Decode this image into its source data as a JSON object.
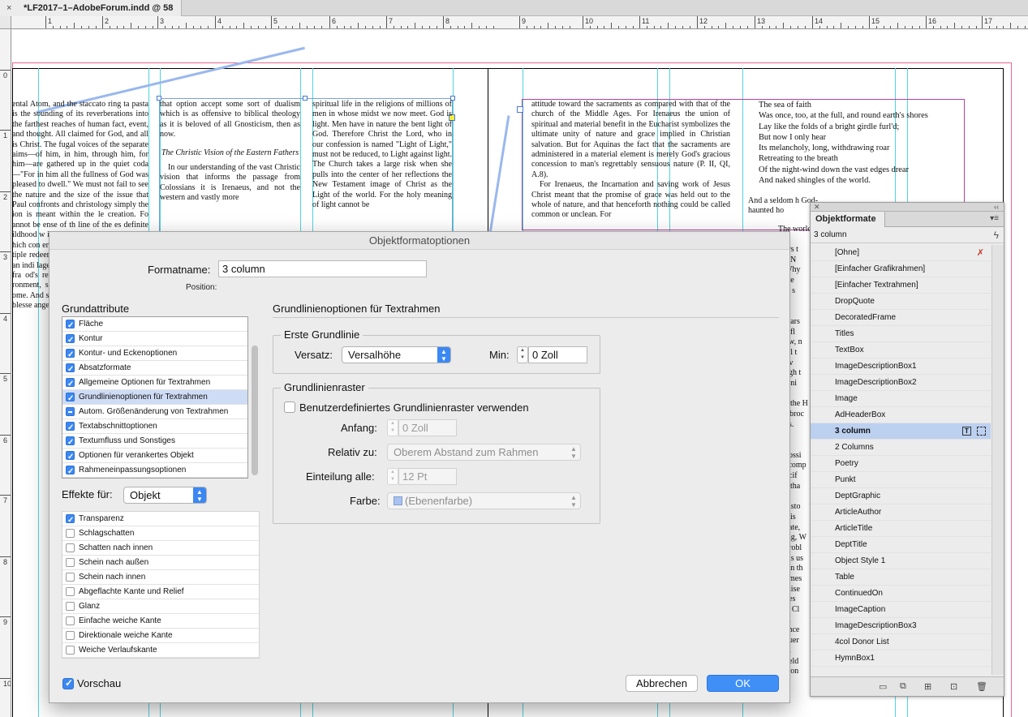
{
  "doc_tab": {
    "close": "×",
    "title": "*LF2017–1–AdobeForum.indd @ 58 %"
  },
  "ruler": {
    "h": [
      "1",
      "2",
      "3",
      "4",
      "5",
      "6",
      "7",
      "8",
      "9",
      "10",
      "11",
      "12",
      "13",
      "14",
      "15",
      "16",
      "17"
    ],
    "v": [
      "0",
      "1",
      "2",
      "3",
      "4",
      "5",
      "6",
      "7",
      "8",
      "9",
      "1\n0"
    ]
  },
  "page_text": {
    "col1": "ental Atom, and the staccato ring ta pasta is the sounding of its reverberations into the farthest reaches of human fact, event, and thought. All claimed for God, and all is Christ. The fugal voices of the separate aims—of him, in him, through him, for him—are gathered up in the quiet coda—\"For in him all the fullness of God was pleased to dwell.\" We must not fail to see the nature and the size of the issue that Paul confronts and christology simply the ion is meant within the le creation. Fo annot be  ense of th line of the es definite ildhood w ith his ne onship wi ne is prepa hich con erder as be ilment and rom the p tiple redeemption s an impl ion. Physical an indi lage and s ondemned ust be fr ther fra od's rede Unless th the r whole of ronment, s orizon, completed main sou ome. And s existence e redemp ion, tra nd blesse angelic ematural an",
    "col2a": "that option accept some sort of dualism which is as offensive to biblical theology as it is beloved of all Gnosticism, then as now.",
    "col2_heading": "The Christic Vision of the Eastern Fathers",
    "col2b": "In our understanding of the vast Christic vision that informs the passage from Colossians it is Irenaeus, and not the western and vastly more",
    "col3": "spiritual life in the religions of millions of men in whose midst we now meet. God is light. Men have in nature the bent light of God. Therefore Christ the Lord, who in our confession is named \"Light of Light,\" must not be reduced, to Light against light. The Church takes a large risk when she pulls into the center of her reflections the New Testament image of Christ as the Light of the world. For the holy meaning of light cannot be",
    "col4a": "attitude toward the sacraments as compared with that of the church of the Middle Ages. For Irenaeus the union of spiritual and material benefit in the Eucharist symbolizes the ultimate unity of nature and grace implied in Christian salvation. But for Aquinas the fact that the sacraments are administered in a material element is merely God's gracious concession to man's regrettably sensuous nature (P. II, QI, A.8).",
    "col4b": "For Irenaeus, the Incarnation and saving work of Jesus Christ meant that the promise of grace was held out to the whole of nature, and that henceforth nothing could be called common or unclean. For",
    "poem": [
      "The sea of faith",
      "Was once, too, at the full, and round earth's shores",
      "Lay like the folds of a bright girdle furl'd;",
      "But now I only hear",
      "Its melancholy, long, withdrawing roar",
      "Retreating to the breath",
      "Of the night-wind down the vast edges drear",
      "And naked shingles of the world."
    ],
    "col5_after": "And a seldom h God-haunted ho",
    "col5_more": "The world is",
    "col6_frag": [
      "ers t",
      "e N",
      "Why",
      "ate",
      "is s",
      "",
      ". .",
      "wars",
      "e fl",
      "ow, n",
      "all t",
      "liv",
      "ugh t",
      "leni",
      "",
      "e the H",
      "l-broc",
      "gs.",
      "",
      "",
      "possi",
      "ecomp",
      "ncif",
      "e tha",
      "it",
      "histo",
      "e is",
      "gate,",
      "ing, W",
      "probl",
      "his us",
      "ein th",
      "omes",
      "mise",
      "ves",
      "s. Cl",
      "nl",
      "ence",
      "nuer",
      "m",
      "held",
      "icon"
    ]
  },
  "dialog": {
    "title": "Objektformatoptionen",
    "formatname_label": "Formatname:",
    "formatname_value": "3 column",
    "position_label": "Position:",
    "basic_attrs_label": "Grundattribute",
    "basic_attrs": [
      {
        "label": "Fläche",
        "state": "on"
      },
      {
        "label": "Kontur",
        "state": "on"
      },
      {
        "label": "Kontur- und Eckenoptionen",
        "state": "on"
      },
      {
        "label": "Absatzformate",
        "state": "on"
      },
      {
        "label": "Allgemeine Optionen für Textrahmen",
        "state": "on"
      },
      {
        "label": "Grundlinienoptionen für Textrahmen",
        "state": "on"
      },
      {
        "label": "Autom. Größenänderung von Textrahmen",
        "state": "partial"
      },
      {
        "label": "Textabschnittoptionen",
        "state": "on"
      },
      {
        "label": "Textumfluss und Sonstiges",
        "state": "on"
      },
      {
        "label": "Optionen für verankertes Objekt",
        "state": "on"
      },
      {
        "label": "Rahmeneinpassungsoptionen",
        "state": "on"
      }
    ],
    "effects_for_label": "Effekte für:",
    "effects_for_value": "Objekt",
    "effects": [
      {
        "label": "Transparenz",
        "state": "on"
      },
      {
        "label": "Schlagschatten",
        "state": "off"
      },
      {
        "label": "Schatten nach innen",
        "state": "off"
      },
      {
        "label": "Schein nach außen",
        "state": "off"
      },
      {
        "label": "Schein nach innen",
        "state": "off"
      },
      {
        "label": "Abgeflachte Kante und Relief",
        "state": "off"
      },
      {
        "label": "Glanz",
        "state": "off"
      },
      {
        "label": "Einfache weiche Kante",
        "state": "off"
      },
      {
        "label": "Direktionale weiche Kante",
        "state": "off"
      },
      {
        "label": "Weiche Verlaufskante",
        "state": "off"
      }
    ],
    "preview_label": "Vorschau",
    "right_title": "Grundlinienoptionen für Textrahmen",
    "first_baseline": {
      "group": "Erste Grundlinie",
      "offset_label": "Versatz:",
      "offset_value": "Versalhöhe",
      "min_label": "Min:",
      "min_value": "0 Zoll"
    },
    "grid": {
      "group": "Grundlinienraster",
      "custom_label": "Benutzerdefiniertes Grundlinienraster verwenden",
      "start_label": "Anfang:",
      "start_value": "0 Zoll",
      "relative_label": "Relativ zu:",
      "relative_value": "Oberem Abstand zum Rahmen",
      "increment_label": "Einteilung alle:",
      "increment_value": "12 Pt",
      "color_label": "Farbe:",
      "color_value": "(Ebenenfarbe)"
    },
    "cancel": "Abbrechen",
    "ok": "OK"
  },
  "panel": {
    "top_left": "✕",
    "top_right": "‹‹",
    "title": "Objektformate",
    "current": "3 column",
    "items": [
      "[Ohne]",
      "[Einfacher Grafikrahmen]",
      "[Einfacher Textrahmen]",
      "DropQuote",
      "DecoratedFrame",
      "Titles",
      "TextBox",
      "ImageDescriptionBox1",
      "ImageDescriptionBox2",
      "Image",
      "AdHeaderBox",
      "3 column",
      "2 Columns",
      "Poetry",
      "Punkt",
      "DeptGraphic",
      "ArticleAuthor",
      "ArticleTitle",
      "DeptTitle",
      "Object Style 1",
      "Table",
      "ContinuedOn",
      "ImageCaption",
      "ImageDescriptionBox3",
      "4col Donor List",
      "HymnBox1"
    ],
    "selected_index": 11
  },
  "colors": {
    "guide": "#50d4de",
    "bleed": "#e46a8c",
    "accent": "#3b88f3",
    "panel_sel": "#bcd0f0"
  }
}
